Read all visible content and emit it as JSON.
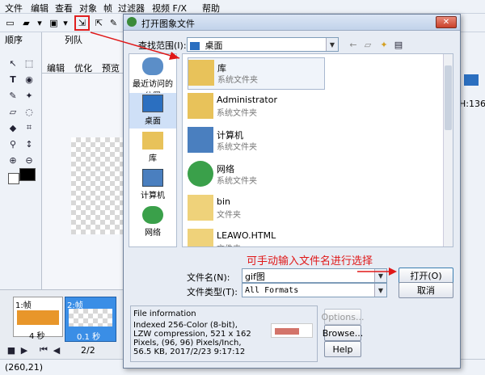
{
  "editor": {
    "menu": [
      "文件",
      "编辑",
      "查看",
      "对象",
      "帧",
      "过滤器",
      "视频 F/X",
      "帮助"
    ],
    "panel_tabs": [
      "顺序",
      "列队"
    ],
    "edit_tabs": [
      "编辑",
      "优化",
      "预览"
    ],
    "frames": [
      {
        "label": "1:帧",
        "delay": "4 秒"
      },
      {
        "label": "2:帧",
        "delay": "0.1 秒"
      }
    ],
    "page_counter": "2/2",
    "status_coords": "(260,21)",
    "right_readout": "H:136"
  },
  "dialog": {
    "title": "打开图象文件",
    "look_in_label": "查找范围(I):",
    "look_in_value": "桌面",
    "places": [
      "最近访问的位置",
      "桌面",
      "库",
      "计算机",
      "网络"
    ],
    "files": [
      {
        "name": "库",
        "type": "系统文件夹",
        "icon": "library-folder-icon"
      },
      {
        "name": "Administrator",
        "type": "系统文件夹",
        "icon": "user-folder-icon"
      },
      {
        "name": "计算机",
        "type": "系统文件夹",
        "icon": "computer-icon"
      },
      {
        "name": "网络",
        "type": "系统文件夹",
        "icon": "network-icon"
      },
      {
        "name": "bin",
        "type": "文件夹",
        "icon": "folder-icon"
      },
      {
        "name": "LEAWO.HTML",
        "type": "文件夹",
        "icon": "folder-icon"
      }
    ],
    "filename_label": "文件名(N):",
    "filename_value": "gif图",
    "filetype_label": "文件类型(T):",
    "filetype_value": "All Formats",
    "open_button": "打开(O)",
    "cancel_button": "取消",
    "file_info_heading": "File information",
    "file_info_text": "Indexed 256-Color (8-bit), LZW compression, 521 x 162 Pixels, (96, 96) Pixels/Inch, 56.5 KB, 2017/2/23 9:17:12",
    "options_button": "Options...",
    "browse_button": "Browse...",
    "help_button": "Help"
  },
  "annotation": "可手动输入文件名进行选择",
  "colors": {
    "annotation": "#e01818",
    "selection": "#cfe0f7",
    "frame_selected": "#3a8ee6"
  }
}
